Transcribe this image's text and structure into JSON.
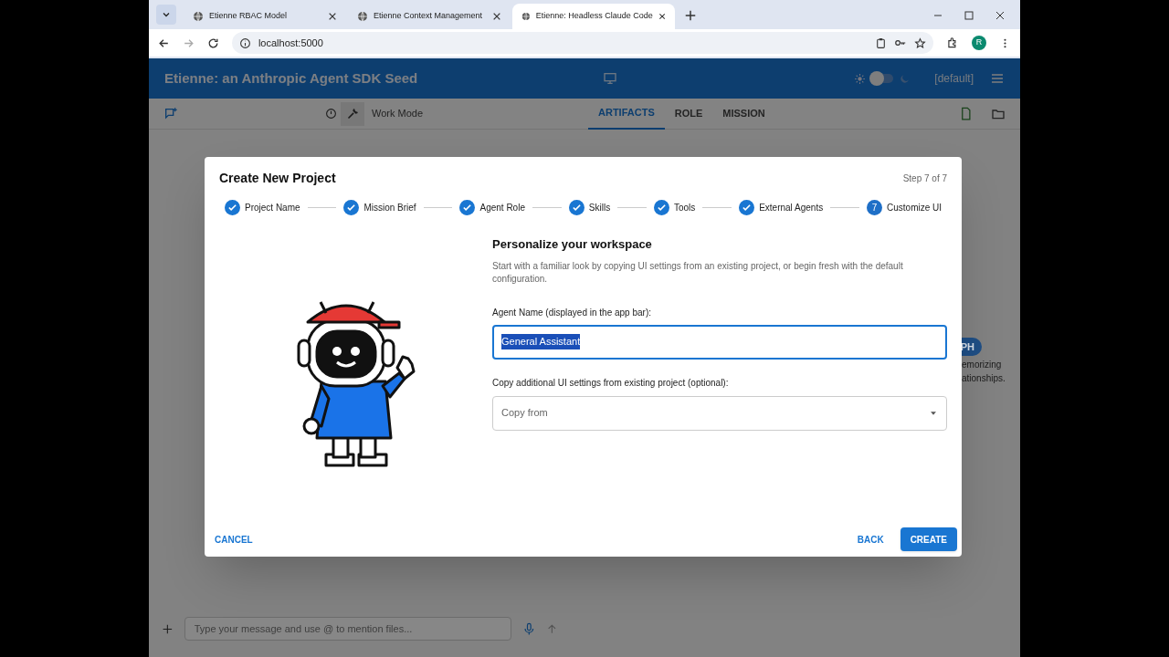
{
  "browser": {
    "tabs": [
      {
        "title": "Etienne RBAC Model",
        "selected": false
      },
      {
        "title": "Etienne Context Management",
        "selected": false
      },
      {
        "title": "Etienne: Headless Claude Code",
        "selected": true
      }
    ],
    "url": "localhost:5000",
    "profile_initial": "R"
  },
  "app_bar": {
    "title": "Etienne: an Anthropic Agent SDK Seed",
    "dark_mode": false,
    "project": "[default]"
  },
  "toolbar": {
    "mode_label": "Work Mode",
    "tabs": [
      {
        "label": "ARTIFACTS",
        "selected": true
      },
      {
        "label": "ROLE",
        "selected": false
      },
      {
        "label": "MISSION",
        "selected": false
      }
    ]
  },
  "background": {
    "badge": "PH",
    "lines": [
      "emorizing",
      "ationships."
    ]
  },
  "chat": {
    "placeholder": "Type your message and use @ to mention files..."
  },
  "dialog": {
    "title": "Create New Project",
    "step_counter": "Step 7 of 7",
    "steps": [
      {
        "label": "Project Name",
        "completed": true
      },
      {
        "label": "Mission Brief",
        "completed": true
      },
      {
        "label": "Agent Role",
        "completed": true
      },
      {
        "label": "Skills",
        "completed": true
      },
      {
        "label": "Tools",
        "completed": true
      },
      {
        "label": "External Agents",
        "completed": true
      },
      {
        "label": "Customize UI",
        "completed": false,
        "number": "7"
      }
    ],
    "heading": "Personalize your workspace",
    "description": "Start with a familiar look by copying UI settings from an existing project, or begin fresh with the default configuration.",
    "agent_name": {
      "label": "Agent Name (displayed in the app bar):",
      "value": "General Assistant",
      "focused": true,
      "text_selected": true
    },
    "copy_from": {
      "label": "Copy additional UI settings from existing project (optional):",
      "placeholder": "Copy from"
    },
    "buttons": {
      "cancel": "CANCEL",
      "back": "BACK",
      "create": "CREATE"
    }
  }
}
